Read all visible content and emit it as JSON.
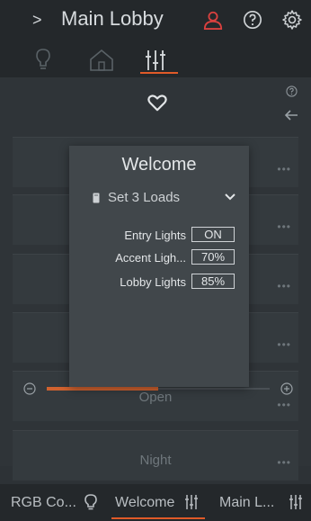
{
  "header": {
    "back_label": ">",
    "title": "Main Lobby"
  },
  "icons": {
    "user": "user-icon",
    "help": "help-icon",
    "settings": "gear-icon",
    "accent": "#d9413f",
    "active": "#e05a28"
  },
  "tabs": [
    {
      "name": "lights",
      "icon": "lightbulb-icon"
    },
    {
      "name": "home",
      "icon": "home-icon"
    },
    {
      "name": "controls",
      "icon": "sliders-icon",
      "active": true
    }
  ],
  "scenes": [
    {
      "label": ""
    },
    {
      "label": ""
    },
    {
      "label": ""
    },
    {
      "label": ""
    },
    {
      "label": "Open"
    },
    {
      "label": "Night"
    }
  ],
  "slider": {
    "level": 0.5
  },
  "modal": {
    "title": "Welcome",
    "selector_text": "Set 3 Loads",
    "loads": [
      {
        "name": "Entry Lights",
        "value": "ON"
      },
      {
        "name": "Accent Ligh...",
        "value": "70%"
      },
      {
        "name": "Lobby Lights",
        "value": "85%"
      }
    ]
  },
  "bottom_tabs": [
    {
      "label": "RGB Co...",
      "icon": "lightbulb-icon"
    },
    {
      "label": "Welcome",
      "icon": "sliders-icon",
      "active": true
    },
    {
      "label": "Main L...",
      "icon": "sliders-icon"
    }
  ]
}
